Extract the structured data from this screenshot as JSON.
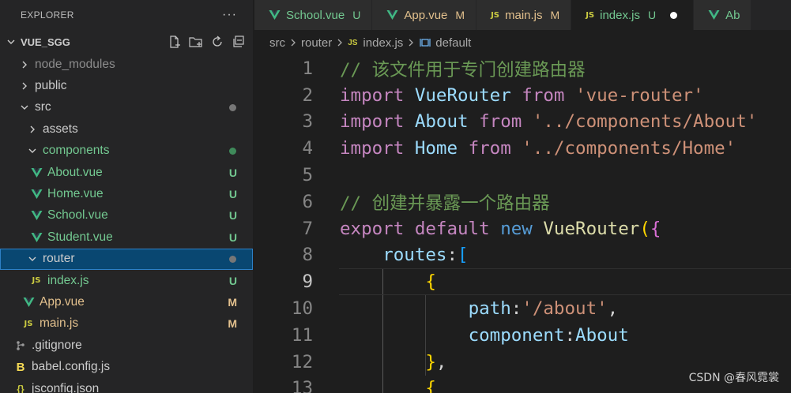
{
  "explorer": {
    "title": "EXPLORER",
    "more": "···",
    "project": "VUE_SGG",
    "actions": [
      "new-file-icon",
      "new-folder-icon",
      "refresh-icon",
      "collapse-icon"
    ],
    "tree": [
      {
        "label": "node_modules",
        "kind": "folder",
        "state": "closed",
        "indent": 0,
        "color": "gray",
        "status": ""
      },
      {
        "label": "public",
        "kind": "folder",
        "state": "closed",
        "indent": 0,
        "color": "white",
        "status": ""
      },
      {
        "label": "src",
        "kind": "folder",
        "state": "open",
        "indent": 0,
        "color": "white",
        "status": "dot-gray"
      },
      {
        "label": "assets",
        "kind": "folder",
        "state": "closed",
        "indent": 1,
        "color": "white",
        "status": ""
      },
      {
        "label": "components",
        "kind": "folder",
        "state": "open",
        "indent": 1,
        "color": "green",
        "status": "dot-green"
      },
      {
        "label": "About.vue",
        "kind": "vue",
        "indent": 2,
        "color": "green",
        "status": "U"
      },
      {
        "label": "Home.vue",
        "kind": "vue",
        "indent": 2,
        "color": "green",
        "status": "U"
      },
      {
        "label": "School.vue",
        "kind": "vue",
        "indent": 2,
        "color": "green",
        "status": "U"
      },
      {
        "label": "Student.vue",
        "kind": "vue",
        "indent": 2,
        "color": "green",
        "status": "U"
      },
      {
        "label": "router",
        "kind": "folder",
        "state": "open",
        "indent": 1,
        "color": "white",
        "status": "dot-gray",
        "selected": true
      },
      {
        "label": "index.js",
        "kind": "js",
        "indent": 2,
        "color": "green",
        "status": "U"
      },
      {
        "label": "App.vue",
        "kind": "vue",
        "indent": 1,
        "color": "yellow",
        "status": "M"
      },
      {
        "label": "main.js",
        "kind": "js",
        "indent": 1,
        "color": "yellow",
        "status": "M"
      },
      {
        "label": ".gitignore",
        "kind": "git",
        "indent": 0,
        "color": "white",
        "status": ""
      },
      {
        "label": "babel.config.js",
        "kind": "babel",
        "indent": 0,
        "color": "white",
        "status": ""
      },
      {
        "label": "jsconfig.json",
        "kind": "json",
        "indent": 0,
        "color": "white",
        "status": ""
      }
    ]
  },
  "tabs": [
    {
      "label": "School.vue",
      "kind": "vue",
      "status": "U",
      "color": "green",
      "active": false
    },
    {
      "label": "App.vue",
      "kind": "vue",
      "status": "M",
      "color": "yellow",
      "active": false
    },
    {
      "label": "main.js",
      "kind": "js",
      "status": "M",
      "color": "yellow",
      "active": false
    },
    {
      "label": "index.js",
      "kind": "js",
      "status": "U",
      "color": "green",
      "active": true,
      "dirty": true
    },
    {
      "label": "Ab",
      "kind": "vue",
      "status": "",
      "color": "green",
      "active": false
    }
  ],
  "breadcrumb": {
    "parts": [
      "src",
      "router",
      "index.js",
      "default"
    ]
  },
  "editor": {
    "current_line": 9,
    "lines": [
      {
        "n": "1",
        "tokens": [
          [
            "comment",
            "// 该文件用于专门创建路由器"
          ]
        ]
      },
      {
        "n": "2",
        "tokens": [
          [
            "kw",
            "import"
          ],
          [
            "plain",
            " "
          ],
          [
            "var",
            "VueRouter"
          ],
          [
            "plain",
            " "
          ],
          [
            "kw",
            "from"
          ],
          [
            "plain",
            " "
          ],
          [
            "str",
            "'vue-router'"
          ]
        ]
      },
      {
        "n": "3",
        "tokens": [
          [
            "kw",
            "import"
          ],
          [
            "plain",
            " "
          ],
          [
            "var",
            "About"
          ],
          [
            "plain",
            " "
          ],
          [
            "kw",
            "from"
          ],
          [
            "plain",
            " "
          ],
          [
            "str",
            "'../components/About'"
          ]
        ]
      },
      {
        "n": "4",
        "tokens": [
          [
            "kw",
            "import"
          ],
          [
            "plain",
            " "
          ],
          [
            "var",
            "Home"
          ],
          [
            "plain",
            " "
          ],
          [
            "kw",
            "from"
          ],
          [
            "plain",
            " "
          ],
          [
            "str",
            "'../components/Home'"
          ]
        ]
      },
      {
        "n": "5",
        "tokens": []
      },
      {
        "n": "6",
        "tokens": [
          [
            "comment",
            "// 创建并暴露一个路由器"
          ]
        ]
      },
      {
        "n": "7",
        "tokens": [
          [
            "kw",
            "export"
          ],
          [
            "plain",
            " "
          ],
          [
            "kw",
            "default"
          ],
          [
            "plain",
            " "
          ],
          [
            "blue",
            "new"
          ],
          [
            "plain",
            " "
          ],
          [
            "fn",
            "VueRouter"
          ],
          [
            "brace1",
            "("
          ],
          [
            "brace2",
            "{"
          ]
        ]
      },
      {
        "n": "8",
        "tokens": [
          [
            "plain",
            "    "
          ],
          [
            "var",
            "routes"
          ],
          [
            "plain",
            ":"
          ],
          [
            "brace3",
            "["
          ]
        ]
      },
      {
        "n": "9",
        "tokens": [
          [
            "plain",
            "        "
          ],
          [
            "brace1",
            "{"
          ]
        ]
      },
      {
        "n": "10",
        "tokens": [
          [
            "plain",
            "            "
          ],
          [
            "var",
            "path"
          ],
          [
            "plain",
            ":"
          ],
          [
            "str",
            "'/about'"
          ],
          [
            "plain",
            ","
          ]
        ]
      },
      {
        "n": "11",
        "tokens": [
          [
            "plain",
            "            "
          ],
          [
            "var",
            "component"
          ],
          [
            "plain",
            ":"
          ],
          [
            "var",
            "About"
          ]
        ]
      },
      {
        "n": "12",
        "tokens": [
          [
            "plain",
            "        "
          ],
          [
            "brace1",
            "}"
          ],
          [
            "plain",
            ","
          ]
        ]
      },
      {
        "n": "13",
        "tokens": [
          [
            "plain",
            "        "
          ],
          [
            "brace1",
            "{"
          ]
        ]
      }
    ]
  },
  "watermark": "CSDN @春风霓裳",
  "colors": {
    "accent": "#094771",
    "untracked": "#73c991",
    "modified": "#e2c08d"
  }
}
